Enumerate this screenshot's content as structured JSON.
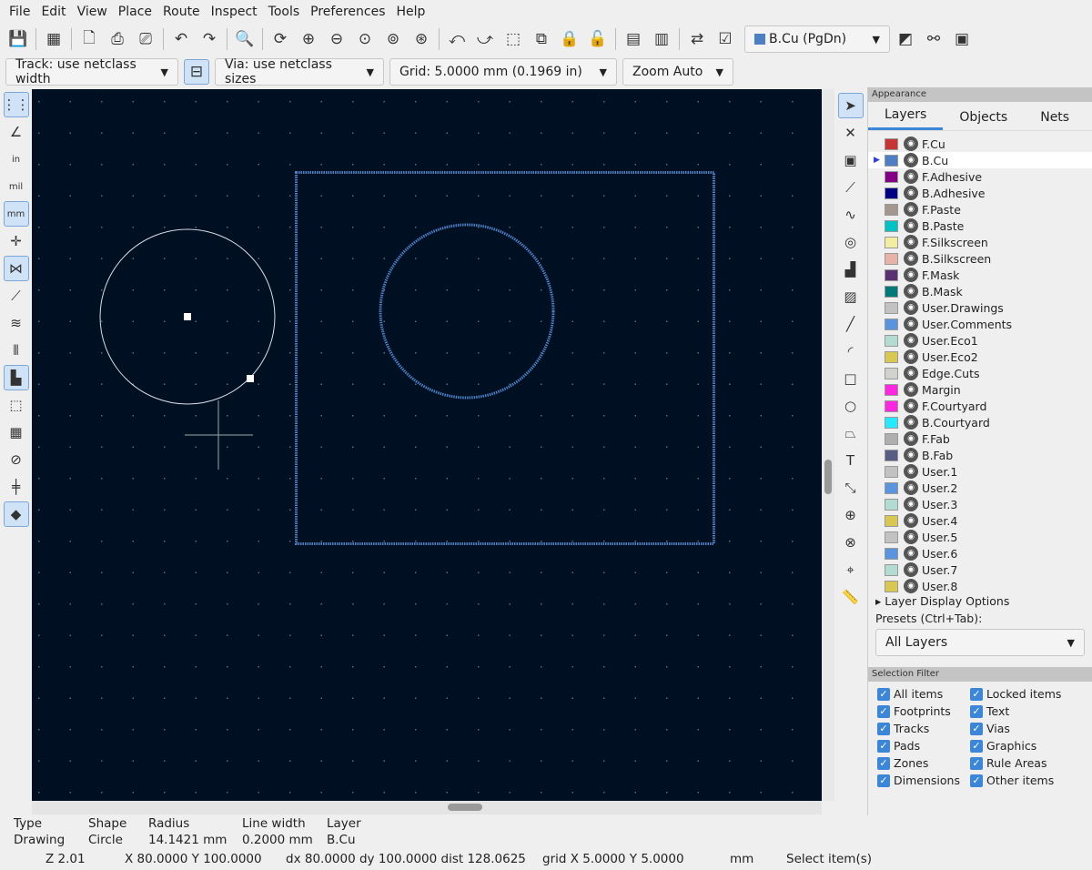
{
  "menu": [
    "File",
    "Edit",
    "View",
    "Place",
    "Route",
    "Inspect",
    "Tools",
    "Preferences",
    "Help"
  ],
  "toolbar": {
    "icons": [
      "save-icon",
      "board-setup-icon",
      "page-settings-icon",
      "print-icon",
      "plot-icon",
      "undo-icon",
      "redo-icon",
      "find-icon",
      "refresh-icon",
      "zoom-in-icon",
      "zoom-out-icon",
      "zoom-fit-icon",
      "zoom-objects-icon",
      "zoom-selection-icon",
      "rotate-ccw-icon",
      "rotate-cw-icon",
      "mirror-icon",
      "group-icon",
      "lock-icon",
      "unlock-icon",
      "netlist-icon",
      "footprint-library-icon",
      "update-pcb-icon",
      "drc-icon"
    ],
    "layer_select": "B.Cu (PgDn)",
    "extra_icons": [
      "layer-pair-icon",
      "footprint-editor-icon",
      "scripting-console-icon"
    ]
  },
  "toolbar2": {
    "track": "Track: use netclass width",
    "via": "Via: use netclass sizes",
    "grid": "Grid: 5.0000 mm (0.1969 in)",
    "zoom": "Zoom Auto"
  },
  "left_tools": [
    {
      "n": "grid-toggle-icon",
      "g": "⋮⋮",
      "on": true
    },
    {
      "n": "polar-coords-icon",
      "g": "∠"
    },
    {
      "n": "units-inch-icon",
      "g": "in"
    },
    {
      "n": "units-mil-icon",
      "g": "mil"
    },
    {
      "n": "units-mm-icon",
      "g": "mm",
      "on": true
    },
    {
      "n": "cursor-fullscreen-icon",
      "g": "✛"
    },
    {
      "n": "ratsnest-icon",
      "g": "⋈",
      "on": true
    },
    {
      "n": "curved-ratsnest-icon",
      "g": "⟋"
    },
    {
      "n": "show-tracks-icon",
      "g": "≋"
    },
    {
      "n": "high-contrast-icon",
      "g": "⫴"
    },
    {
      "n": "zone-fill-icon",
      "g": "▙",
      "on": true
    },
    {
      "n": "zone-outline-icon",
      "g": "⬚"
    },
    {
      "n": "pad-outline-icon",
      "g": "▦"
    },
    {
      "n": "via-outline-icon",
      "g": "⊘"
    },
    {
      "n": "track-outline-icon",
      "g": "╪"
    },
    {
      "n": "appearance-panel-icon",
      "g": "◆",
      "on": true
    }
  ],
  "right_tools": [
    {
      "n": "select-icon",
      "g": "➤",
      "on": true
    },
    {
      "n": "local-ratsnest-icon",
      "g": "✕"
    },
    {
      "n": "add-footprint-icon",
      "g": "▣"
    },
    {
      "n": "route-track-icon",
      "g": "⟋"
    },
    {
      "n": "tune-length-icon",
      "g": "∿"
    },
    {
      "n": "add-via-icon",
      "g": "◎"
    },
    {
      "n": "add-zone-icon",
      "g": "▟"
    },
    {
      "n": "add-rule-area-icon",
      "g": "▨"
    },
    {
      "n": "draw-line-icon",
      "g": "╱"
    },
    {
      "n": "draw-arc-icon",
      "g": "◜"
    },
    {
      "n": "draw-rectangle-icon",
      "g": "□"
    },
    {
      "n": "draw-circle-icon",
      "g": "○"
    },
    {
      "n": "draw-polygon-icon",
      "g": "⏢"
    },
    {
      "n": "add-text-icon",
      "g": "T"
    },
    {
      "n": "add-dimension-icon",
      "g": "⤡"
    },
    {
      "n": "place-origin-icon",
      "g": "⊕"
    },
    {
      "n": "delete-tool-icon",
      "g": "⊗"
    },
    {
      "n": "grid-origin-icon",
      "g": "⌖"
    },
    {
      "n": "measure-icon",
      "g": "📏"
    }
  ],
  "panel": {
    "title": "Appearance",
    "tabs": [
      "Layers",
      "Objects",
      "Nets"
    ],
    "layers": [
      [
        "F.Cu",
        "#c83434"
      ],
      [
        "B.Cu",
        "#4d7fc4"
      ],
      [
        "F.Adhesive",
        "#840084"
      ],
      [
        "B.Adhesive",
        "#000084"
      ],
      [
        "F.Paste",
        "#a49790"
      ],
      [
        "B.Paste",
        "#00c2c2"
      ],
      [
        "F.Silkscreen",
        "#f2eda1"
      ],
      [
        "B.Silkscreen",
        "#e8b2a7"
      ],
      [
        "F.Mask",
        "#593071"
      ],
      [
        "B.Mask",
        "#027979"
      ],
      [
        "User.Drawings",
        "#c2c2c2"
      ],
      [
        "User.Comments",
        "#5994dc"
      ],
      [
        "User.Eco1",
        "#b4dbd2"
      ],
      [
        "User.Eco2",
        "#d8c852"
      ],
      [
        "Edge.Cuts",
        "#d0d2cd"
      ],
      [
        "Margin",
        "#ff26e2"
      ],
      [
        "F.Courtyard",
        "#ff26e2"
      ],
      [
        "B.Courtyard",
        "#26e9ff"
      ],
      [
        "F.Fab",
        "#afafaf"
      ],
      [
        "B.Fab",
        "#585d84"
      ],
      [
        "User.1",
        "#c2c2c2"
      ],
      [
        "User.2",
        "#5994dc"
      ],
      [
        "User.3",
        "#b4dbd2"
      ],
      [
        "User.4",
        "#d8c852"
      ],
      [
        "User.5",
        "#c2c2c2"
      ],
      [
        "User.6",
        "#5994dc"
      ],
      [
        "User.7",
        "#b4dbd2"
      ],
      [
        "User.8",
        "#d8c852"
      ]
    ],
    "selected_layer": "B.Cu",
    "layer_display_options": "Layer Display Options",
    "presets_label": "Presets (Ctrl+Tab):",
    "presets_value": "All Layers",
    "selection_filter_title": "Selection Filter",
    "filters": [
      "All items",
      "Locked items",
      "Footprints",
      "Text",
      "Tracks",
      "Vias",
      "Pads",
      "Graphics",
      "Zones",
      "Rule Areas",
      "Dimensions",
      "Other items"
    ]
  },
  "msg": {
    "headers": [
      "Type",
      "Shape",
      "Radius",
      "Line width",
      "Layer"
    ],
    "values": [
      "Drawing",
      "Circle",
      "14.1421 mm",
      "0.2000 mm",
      "B.Cu"
    ]
  },
  "status": {
    "zoom": "Z 2.01",
    "pos": "X 80.0000  Y 100.0000",
    "delta": "dx 80.0000  dy 100.0000  dist 128.0625",
    "grid": "grid X 5.0000  Y 5.0000",
    "units": "mm",
    "mode": "Select item(s)"
  },
  "colors": {
    "canvas": "#001023",
    "grid": "#5a6a80",
    "edge": "#d0d2cd",
    "bcu": "#4d7fc4",
    "accent": "#3b86d8"
  }
}
